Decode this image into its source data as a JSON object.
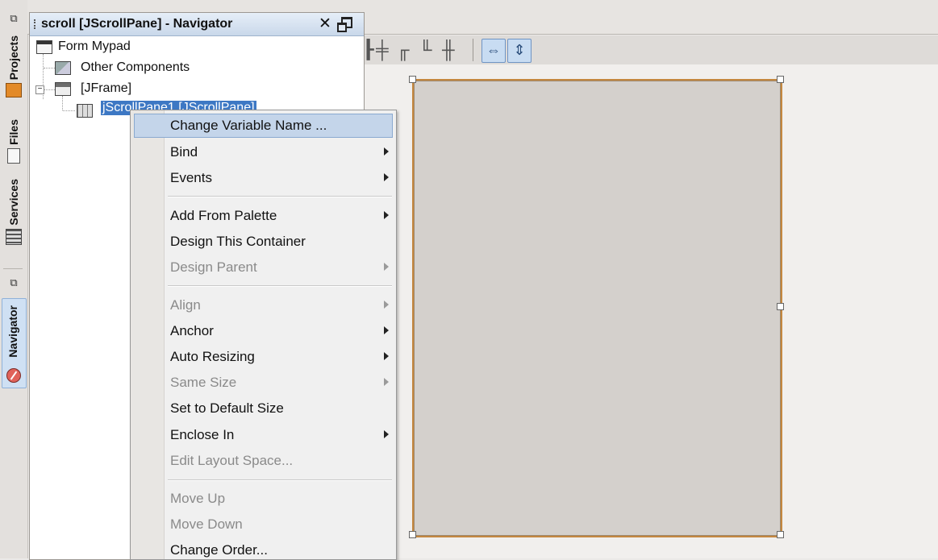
{
  "sidebar": {
    "tabs": [
      {
        "label": "Projects",
        "icon": "projects-icon"
      },
      {
        "label": "Files",
        "icon": "files-icon"
      },
      {
        "label": "Services",
        "icon": "services-icon"
      },
      {
        "label": "Navigator",
        "icon": "compass-icon",
        "active": true
      }
    ]
  },
  "navigator": {
    "title": "scroll [JScrollPane] - Navigator",
    "close_symbol": "✕",
    "tree": {
      "root": "Form Mypad",
      "other": "Other Components",
      "frame": "[JFrame]",
      "selected": "jScrollPane1 [JScrollPane]"
    }
  },
  "toolbar": {
    "icons": [
      "align-left-icon",
      "align-center-icon",
      "align-top-icon",
      "align-bottom-icon",
      "align-middle-icon",
      "horizontal-resize-icon",
      "vertical-resize-icon"
    ]
  },
  "context_menu": {
    "items": [
      {
        "label": "Change Variable Name ...",
        "submenu": false,
        "disabled": false,
        "highlighted": true
      },
      {
        "label": "Bind",
        "submenu": true,
        "disabled": false
      },
      {
        "label": "Events",
        "submenu": true,
        "disabled": false
      },
      {
        "label": "Add From Palette",
        "submenu": true,
        "disabled": false
      },
      {
        "label": "Design This Container",
        "submenu": false,
        "disabled": false
      },
      {
        "label": "Design Parent",
        "submenu": true,
        "disabled": true
      },
      {
        "label": "Align",
        "submenu": true,
        "disabled": true
      },
      {
        "label": "Anchor",
        "submenu": true,
        "disabled": false
      },
      {
        "label": "Auto Resizing",
        "submenu": true,
        "disabled": false
      },
      {
        "label": "Same Size",
        "submenu": true,
        "disabled": true
      },
      {
        "label": "Set to Default Size",
        "submenu": false,
        "disabled": false
      },
      {
        "label": "Enclose In",
        "submenu": true,
        "disabled": false
      },
      {
        "label": "Edit Layout Space...",
        "submenu": false,
        "disabled": true
      },
      {
        "label": "Move Up",
        "submenu": false,
        "disabled": true
      },
      {
        "label": "Move Down",
        "submenu": false,
        "disabled": true
      },
      {
        "label": "Change Order...",
        "submenu": false,
        "disabled": false
      }
    ]
  },
  "colors": {
    "selection": "#3d78c4",
    "menu_highlight": "#c4d5ea",
    "form_border": "#c4873f"
  }
}
